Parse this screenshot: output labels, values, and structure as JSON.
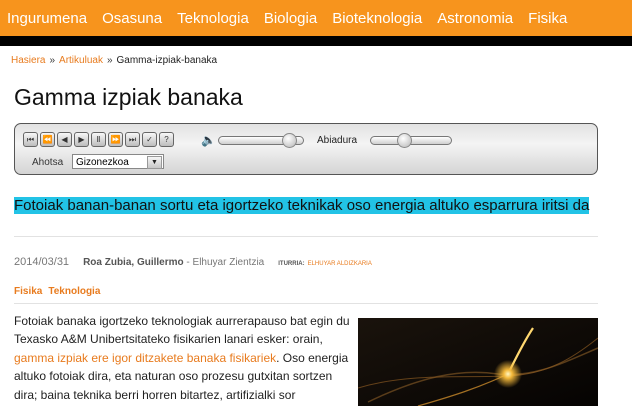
{
  "nav": {
    "items": [
      "Ingurumena",
      "Osasuna",
      "Teknologia",
      "Biologia",
      "Bioteknologia",
      "Astronomia",
      "Fisika"
    ]
  },
  "breadcrumb": {
    "home": "Hasiera",
    "section": "Artikuluak",
    "separator": "»",
    "current": "Gamma-izpiak-banaka"
  },
  "article": {
    "title": "Gamma izpiak banaka",
    "subtitle": "Fotoiak banan-banan sortu eta igortzeko teknikak oso energia altuko esparrura iritsi da",
    "date": "2014/03/31",
    "authors": "Roa Zubia, Guillermo",
    "publisher": " - Elhuyar Zientzia",
    "source_label": "ITURRIA:",
    "source": "ELHUYAR ALDIZKARIA",
    "tags": [
      "Fisika",
      "Teknologia"
    ],
    "body_intro": "Fotoiak banaka igortzeko teknologiak aurrerapauso bat egin du Texasko A&M Unibertsitateko fisikarien lanari esker: orain, ",
    "body_link": "gamma izpiak ere igor ditzakete banaka fisikariek",
    "body_rest": ". Oso energia altuko fotoiak dira, eta naturan oso prozesu gutxitan sortzen dira; baina teknika berri horren bitartez, artifizialki sor"
  },
  "player": {
    "speed_label": "Abiadura",
    "voice_label": "Ahotsa",
    "voice_value": "Gizonezkoa",
    "volume_level": 0.9,
    "speed_level": 0.4,
    "buttons": [
      {
        "icon": "skip-back-icon",
        "glyph": "⏮"
      },
      {
        "icon": "rewind-icon",
        "glyph": "⏪"
      },
      {
        "icon": "previous-icon",
        "glyph": "◀"
      },
      {
        "icon": "play-icon",
        "glyph": "▶"
      },
      {
        "icon": "pause-icon",
        "glyph": "Ⅱ"
      },
      {
        "icon": "fast-forward-icon",
        "glyph": "⏩"
      },
      {
        "icon": "skip-forward-icon",
        "glyph": "⏭"
      },
      {
        "icon": "settings-icon",
        "glyph": "✓"
      },
      {
        "icon": "help-icon",
        "glyph": "?"
      }
    ]
  },
  "colors": {
    "nav_bg": "#f7941d",
    "accent": "#e87b1e",
    "highlight": "#22c3e6"
  }
}
